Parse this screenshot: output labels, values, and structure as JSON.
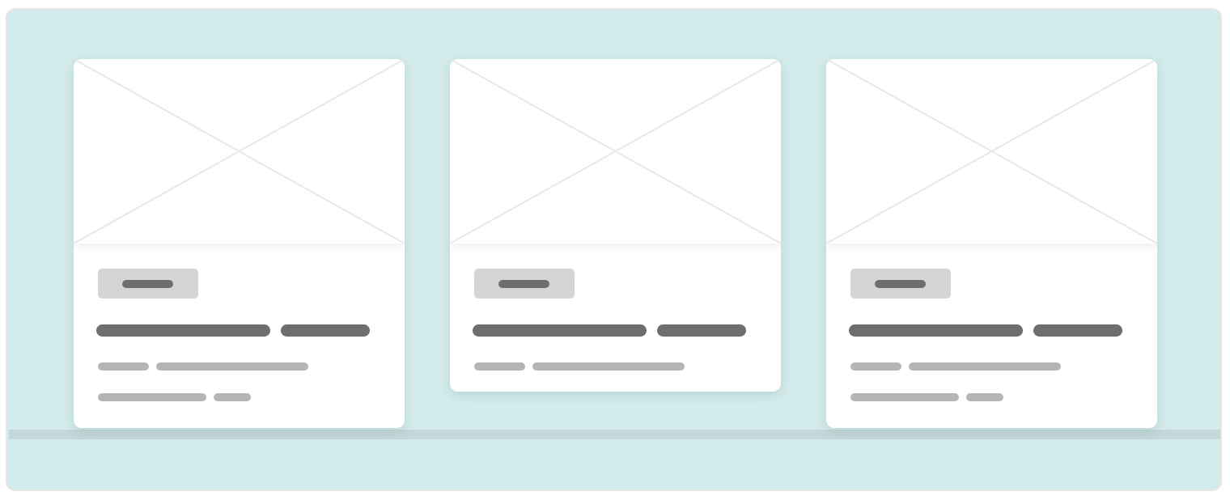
{
  "colors": {
    "canvas_background": "#d4ebeb",
    "divider_band": "#c3d8d9",
    "card_background": "#ffffff",
    "badge_background": "#d5d5d5",
    "placeholder_bar_dark": "#6e6e6e",
    "placeholder_bar_light": "#b5b5b5",
    "image_placeholder_lines": "#e8e8e8"
  },
  "cards": [
    {
      "image": "image-placeholder-icon",
      "meta_lines": 2
    },
    {
      "image": "image-placeholder-icon",
      "meta_lines": 1
    },
    {
      "image": "image-placeholder-icon",
      "meta_lines": 2
    }
  ]
}
